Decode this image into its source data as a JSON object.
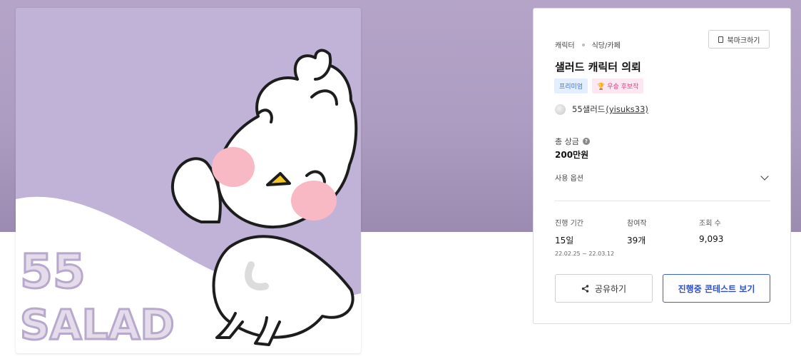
{
  "artwork": {
    "watermark_line1": "55",
    "watermark_line2": "SALAD",
    "colors": {
      "background": "#c1b2d7",
      "cheek": "#f8b8c4",
      "beak": "#f6c52a"
    }
  },
  "panel": {
    "breadcrumb": [
      "캐릭터",
      "식당/카페"
    ],
    "bookmark_label": "북마크하기",
    "title": "샐러드 캐릭터 의뢰",
    "badges": {
      "premium": "프리미엄",
      "award": "🏆 우승 후보작"
    },
    "author": {
      "name": "55샐러드",
      "handle": "(yisuks33)"
    },
    "prize": {
      "label": "총 상금",
      "value": "200만원"
    },
    "options_label": "사용 옵션",
    "stats": {
      "period": {
        "label": "진행 기간",
        "value": "15일",
        "sub": "22.02.25 ~ 22.03.12"
      },
      "entries": {
        "label": "참여작",
        "value": "39개"
      },
      "views": {
        "label": "조회 수",
        "value": "9,093"
      }
    },
    "share_label": "공유하기",
    "view_label": "진행중 콘테스트 보기",
    "accent_color": "#3b5fd6"
  }
}
